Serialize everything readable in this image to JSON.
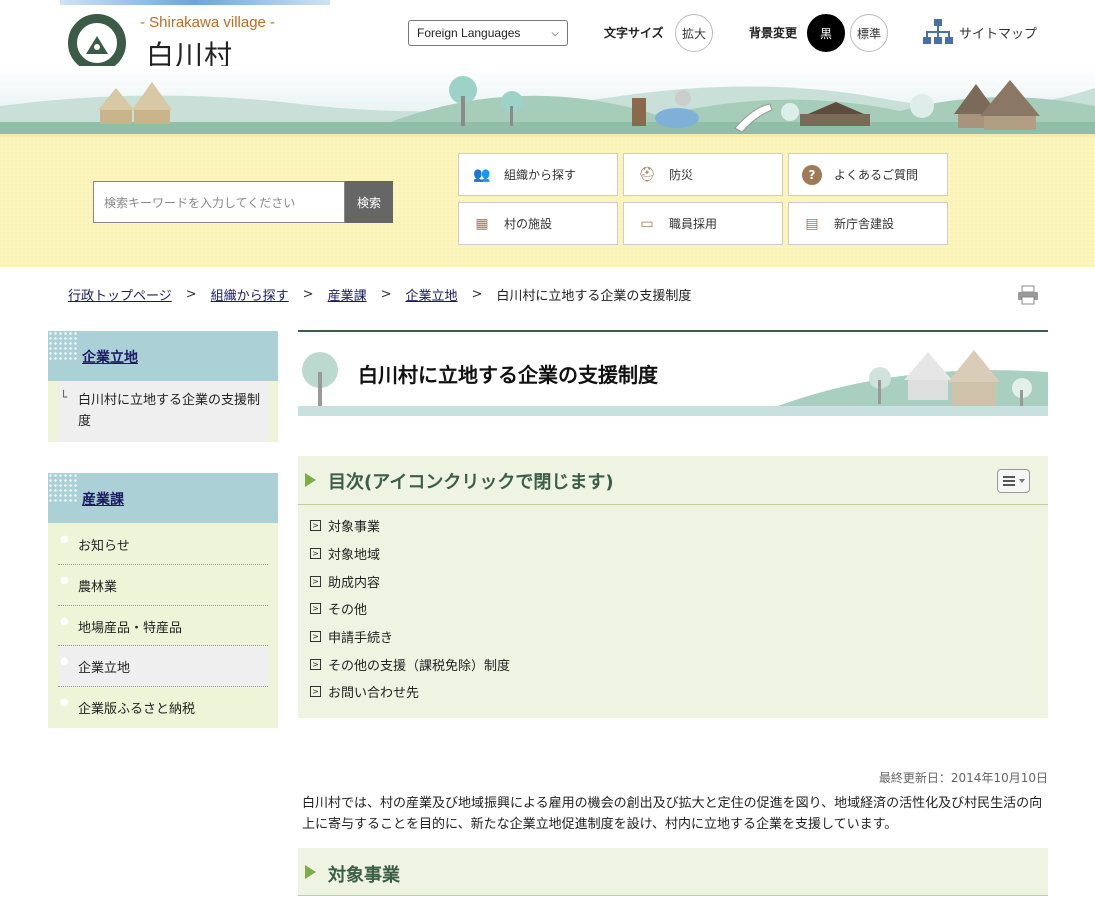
{
  "header": {
    "logo_en": "- Shirakawa village -",
    "logo_ja": "白川村",
    "language_select": "Foreign Languages",
    "font_size_label": "文字サイズ",
    "font_size_button": "拡大",
    "bg_label": "背景変更",
    "bg_black": "黒",
    "bg_standard": "標準",
    "sitemap": "サイトマップ"
  },
  "search": {
    "placeholder": "検索キーワードを入力してください",
    "button": "検索"
  },
  "quick_links": [
    {
      "label": "組織から探す",
      "icon": "people-icon"
    },
    {
      "label": "防災",
      "icon": "helmet-icon"
    },
    {
      "label": "よくあるご質問",
      "icon": "question-icon"
    },
    {
      "label": "村の施設",
      "icon": "building-icon"
    },
    {
      "label": "職員採用",
      "icon": "id-card-icon"
    },
    {
      "label": "新庁舎建設",
      "icon": "construction-icon"
    }
  ],
  "breadcrumb": [
    "行政トップページ",
    "組織から探す",
    "産業課",
    "企業立地",
    "白川村に立地する企業の支援制度"
  ],
  "sidebar": {
    "box1": {
      "title": "企業立地",
      "items": [
        "白川村に立地する企業の支援制度"
      ]
    },
    "box2": {
      "title": "産業課",
      "items": [
        "お知らせ",
        "農林業",
        "地場産品・特産品",
        "企業立地",
        "企業版ふるさと納税"
      ]
    }
  },
  "main": {
    "title": "白川村に立地する企業の支援制度",
    "toc_title": "目次(アイコンクリックで閉じます)",
    "toc_items": [
      "対象事業",
      "対象地域",
      "助成内容",
      "その他",
      "申請手続き",
      "その他の支援（課税免除）制度",
      "お問い合わせ先"
    ],
    "updated": "最終更新日：2014年10月10日",
    "intro": "白川村では、村の産業及び地域振興による雇用の機会の創出及び拡大と定住の促進を図り、地域経済の活性化及び村民生活の向上に寄与することを目的に、新たな企業立地促進制度を設け、村内に立地する企業を支援しています。",
    "section1_title": "対象事業"
  },
  "colors": {
    "accent_green": "#3b5e48",
    "toc_bg": "#eff4e2",
    "sidebar_head": "#abd1d6",
    "yellow_band": "#faf4b8"
  }
}
